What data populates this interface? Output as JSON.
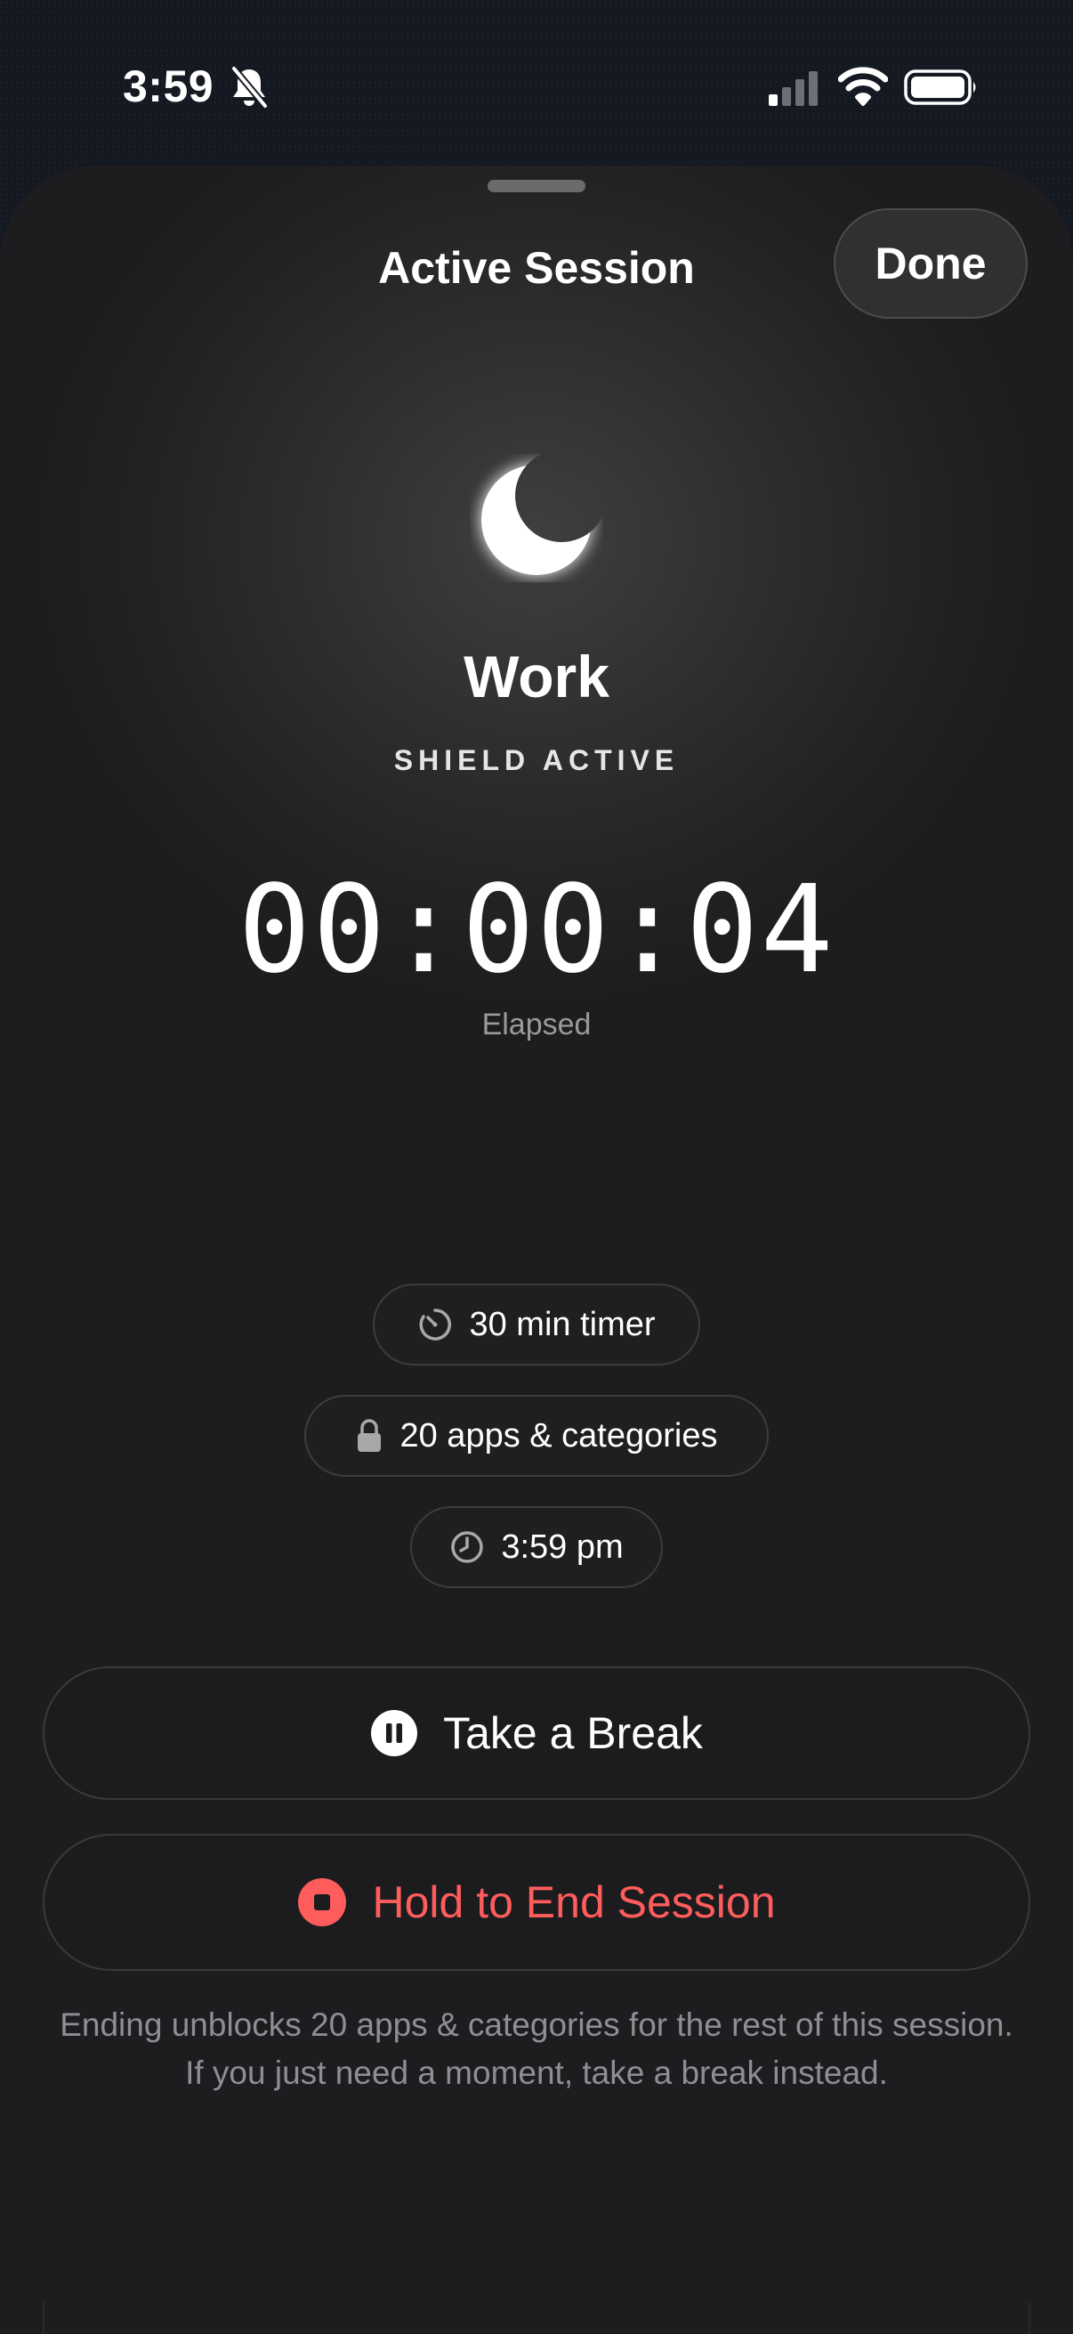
{
  "status_bar": {
    "time": "3:59",
    "icons": [
      "bell-off-icon",
      "signal-icon",
      "wifi-icon",
      "battery-icon"
    ]
  },
  "sheet": {
    "title": "Active Session",
    "done_label": "Done"
  },
  "session": {
    "icon": "moon-icon",
    "name": "Work",
    "status": "SHIELD ACTIVE",
    "elapsed": "00:00:04",
    "elapsed_label": "Elapsed"
  },
  "details": {
    "timer": "30 min timer",
    "apps": "20 apps & categories",
    "start_time": "3:59 pm"
  },
  "actions": {
    "break_label": "Take a Break",
    "end_label": "Hold to End Session"
  },
  "footnote": "Ending unblocks 20 apps & categories for the rest of this session. If you just need a moment, take a break instead.",
  "colors": {
    "accent_red": "#ff5c5c",
    "background": "#1d1d1f"
  }
}
